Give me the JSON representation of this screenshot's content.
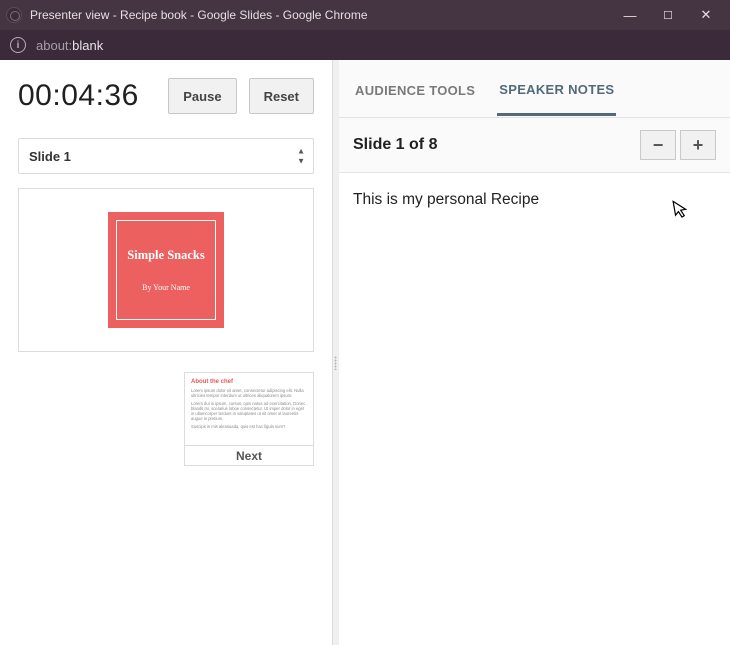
{
  "window": {
    "title": "Presenter view - Recipe book - Google Slides - Google Chrome"
  },
  "address": {
    "scheme": "about:",
    "rest": "blank"
  },
  "timer": {
    "value": "00:04:36",
    "pause_label": "Pause",
    "reset_label": "Reset"
  },
  "slide_select": {
    "label": "Slide 1"
  },
  "current_slide": {
    "title": "Simple Snacks",
    "byline": "By Your Name"
  },
  "next_slide": {
    "title": "About the chef",
    "line1": "Lorem ipsum dolor sit amet, consectetur adipiscing elit. Nulla ultricies tempor interdum ut ultrices aliqualorem ipsum.",
    "line2": "Lorem dui in ipsum, cursus, quis natus ad exercitation. Donec blandit mi, scelarius loboe consectetur. Ut imper dolor in eget in ullamcorper terdunt in valuptates ut sit omet ut laoreetis augue in pretium.",
    "line3": "Suscipit in mis aleasuada, quis est hac ligula sum?",
    "next_label": "Next"
  },
  "tabs": {
    "audience": "AUDIENCE TOOLS",
    "speaker": "SPEAKER NOTES"
  },
  "notes": {
    "slide_of": "Slide 1 of 8",
    "text": "This is my personal Recipe",
    "minus": "−",
    "plus": "+"
  }
}
